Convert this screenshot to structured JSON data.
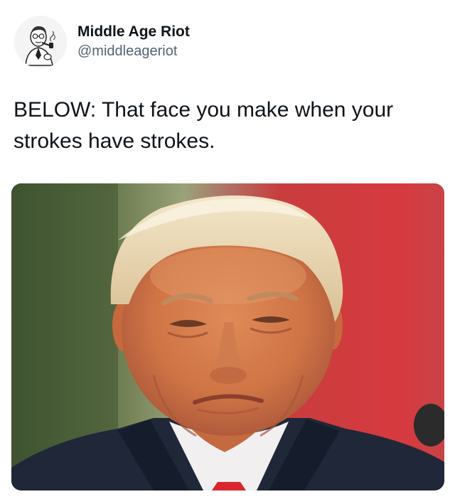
{
  "post": {
    "author": {
      "display_name": "Middle Age Riot",
      "handle": "@middleageriot",
      "avatar_icon": "vintage-man-with-pipe-illustration"
    },
    "text": "BELOW: That face you make when your strokes have strokes.",
    "media": {
      "kind": "photo",
      "subject": "man-portrait-photo"
    }
  },
  "colors": {
    "text_primary": "#0f1419",
    "text_secondary": "#536471",
    "background": "#ffffff"
  }
}
